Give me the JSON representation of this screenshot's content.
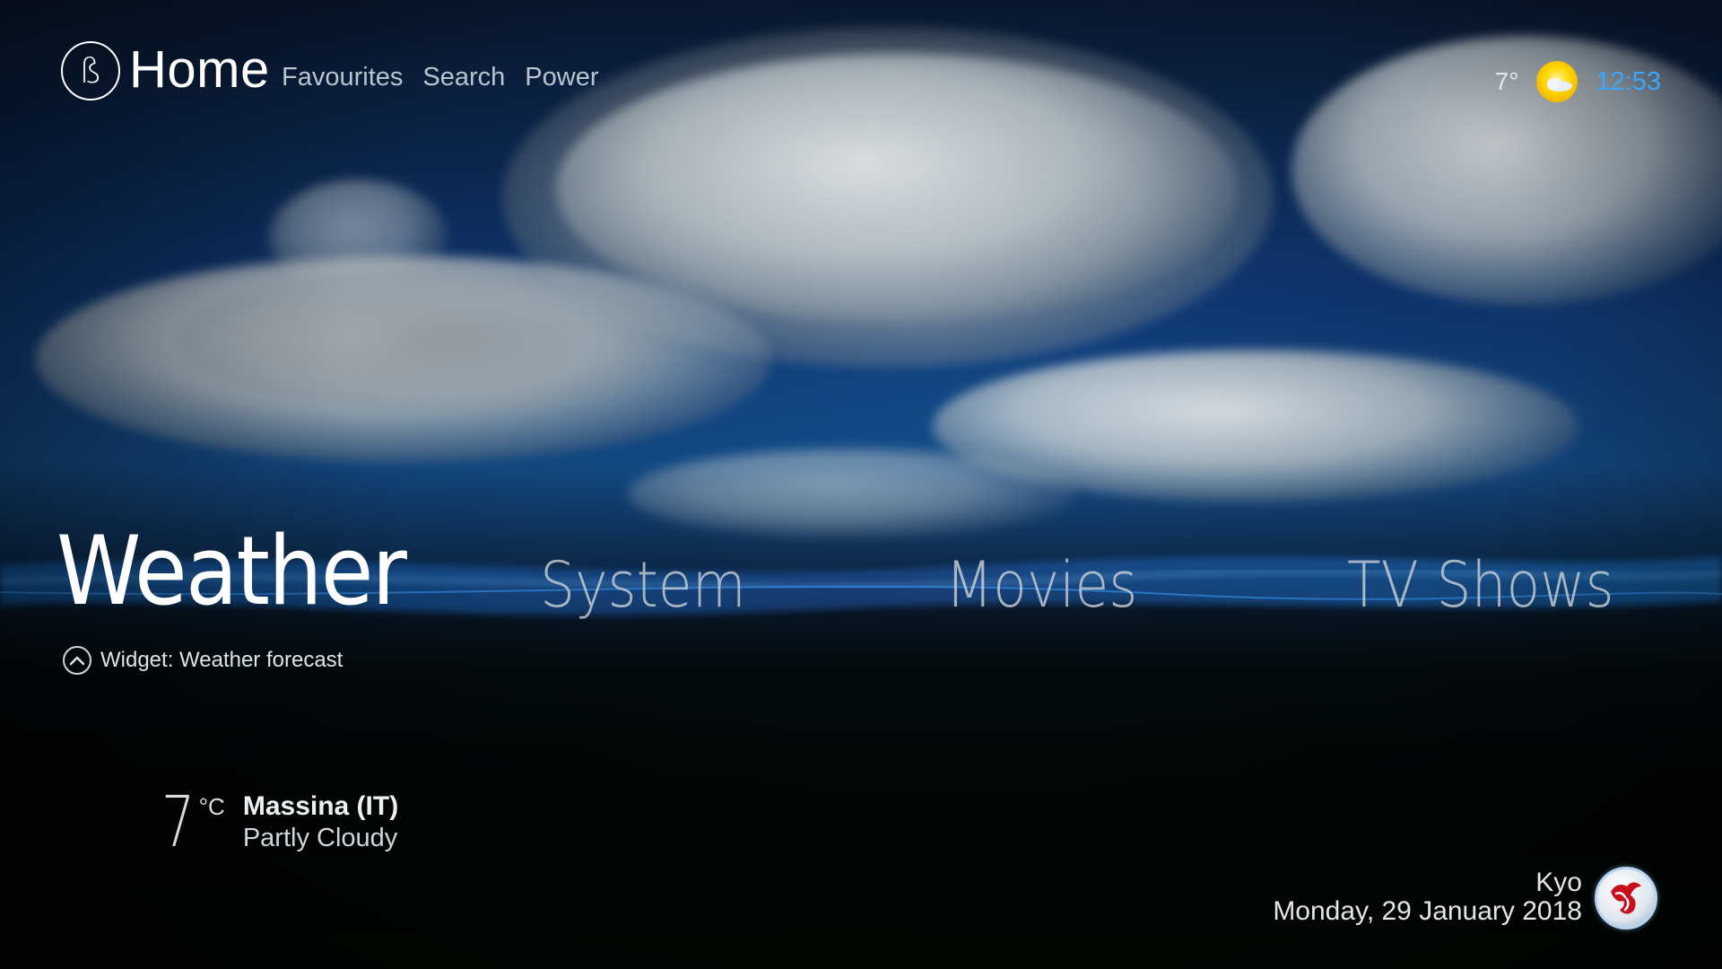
{
  "header": {
    "logo_glyph": "ß",
    "title": "Home",
    "nav": [
      "Favourites",
      "Search",
      "Power"
    ]
  },
  "status": {
    "temperature": "7°",
    "weather_icon": "sun-cloud-icon",
    "time": "12:53",
    "time_color": "#3aa7ff"
  },
  "menu": {
    "items": [
      "Weather",
      "System",
      "Movies",
      "TV Shows"
    ],
    "focused": "Weather"
  },
  "widget_hint": {
    "icon": "chevron-up-circle-icon",
    "label": "Widget: Weather forecast"
  },
  "weather_widget": {
    "temperature": "7",
    "unit": "°C",
    "location": "Massina (IT)",
    "condition": "Partly Cloudy"
  },
  "user": {
    "name": "Kyo",
    "date": "Monday, 29 January 2018",
    "avatar_icon": "profile-avatar-icon"
  },
  "colors": {
    "accent_blue": "#3aa7ff",
    "sun_yellow": "#ffd800"
  }
}
